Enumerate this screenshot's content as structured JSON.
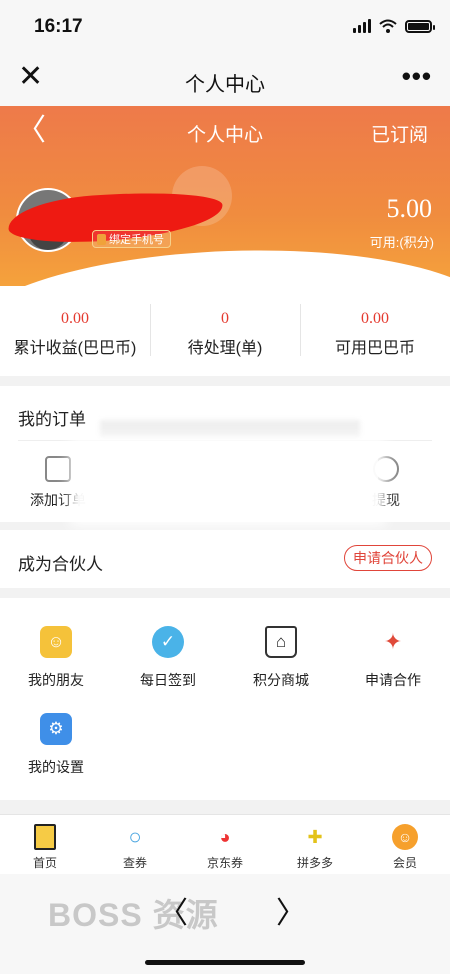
{
  "status": {
    "time": "16:17"
  },
  "wechat": {
    "close": "✕",
    "title": "个人中心",
    "more": "•••"
  },
  "header": {
    "back": "〈",
    "title": "个人中心",
    "subscribe": "已订阅",
    "bind_phone": "绑定手机号",
    "points": "5.00",
    "points_label": "可用:(积分)"
  },
  "stats": [
    {
      "value": "0.00",
      "label": "累计收益(巴巴币)"
    },
    {
      "value": "0",
      "label": "待处理(单)"
    },
    {
      "value": "0.00",
      "label": "可用巴巴币"
    }
  ],
  "orders": {
    "title": "我的订单",
    "left_label": "添加订单",
    "right_label": "提现"
  },
  "partner": {
    "title": "成为合伙人",
    "button": "申请合伙人"
  },
  "grid": [
    {
      "label": "我的朋友",
      "icon": "friends-icon"
    },
    {
      "label": "每日签到",
      "icon": "calendar-check-icon"
    },
    {
      "label": "积分商城",
      "icon": "shop-icon"
    },
    {
      "label": "申请合作",
      "icon": "handshake-icon"
    },
    {
      "label": "我的设置",
      "icon": "gear-icon"
    }
  ],
  "tabs": [
    {
      "label": "首页",
      "icon": "home-icon"
    },
    {
      "label": "查券",
      "icon": "search-icon"
    },
    {
      "label": "京东券",
      "icon": "jd-dog-icon"
    },
    {
      "label": "拼多多",
      "icon": "pdd-icon"
    },
    {
      "label": "会员",
      "icon": "member-icon"
    }
  ],
  "bottom": {
    "watermark": "BOSS 资源",
    "back": "〈",
    "forward": "〉"
  },
  "colors": {
    "accent": "#ee7a4a",
    "value_red": "#e43a2f"
  }
}
